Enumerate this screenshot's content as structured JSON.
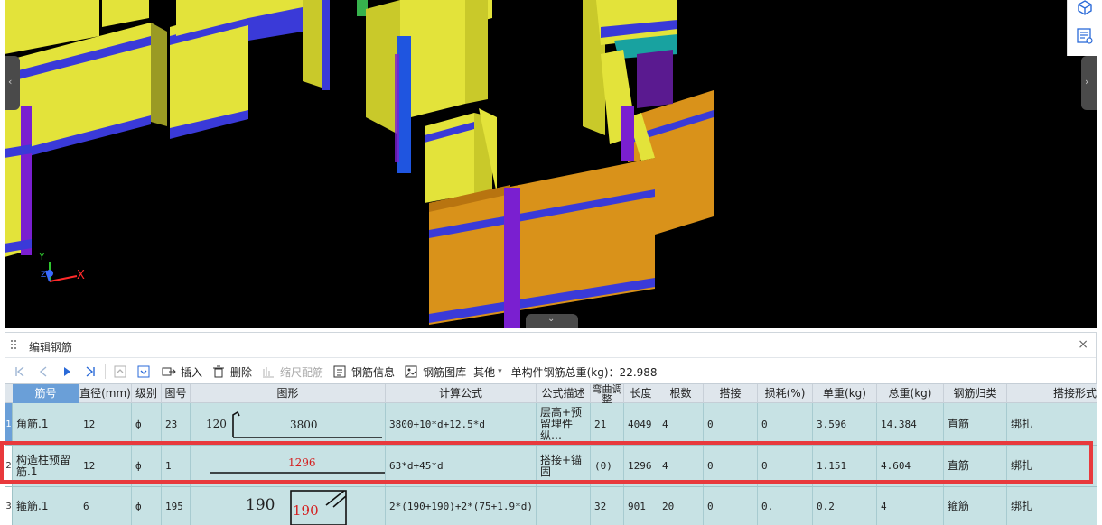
{
  "viewport": {
    "axis_labels": {
      "x": "X",
      "y": "Y",
      "z": "Z"
    },
    "icons": [
      "cube-icon",
      "layer-view-icon"
    ]
  },
  "panel": {
    "title": "编辑钢筋",
    "close": "×"
  },
  "toolbar": {
    "insert": "插入",
    "delete": "删除",
    "scale_bars": "缩尺配筋",
    "rebar_info": "钢筋信息",
    "rebar_library": "钢筋图库",
    "other": "其他",
    "other_arrow": "▾",
    "total_weight": "单构件钢筋总重(kg)：22.988"
  },
  "table": {
    "headers": [
      "筋号",
      "直径(mm)",
      "级别",
      "图号",
      "图形",
      "计算公式",
      "公式描述",
      "弯曲调整",
      "长度",
      "根数",
      "搭接",
      "损耗(%)",
      "单重(kg)",
      "总重(kg)",
      "钢筋归类",
      "搭接形式"
    ],
    "rows": [
      {
        "num": "1",
        "name": "角筋.1",
        "dia": "12",
        "grade": "ф",
        "fig": "23",
        "shape": {
          "left": "120",
          "main": "3800"
        },
        "formula": "3800+10*d+12.5*d",
        "desc": "层高+预留埋件纵…",
        "bend": "21",
        "length": "4049",
        "count": "4",
        "lap": "0",
        "loss": "0",
        "unit_wt": "3.596",
        "total_wt": "14.384",
        "class": "直筋",
        "lap_type": "绑扎"
      },
      {
        "num": "2",
        "name": "构造柱预留筋.1",
        "dia": "12",
        "grade": "ф",
        "fig": "1",
        "shape": {
          "main": "1296"
        },
        "formula": "63*d+45*d",
        "desc": "搭接+锚固",
        "bend": "(0)",
        "length": "1296",
        "count": "4",
        "lap": "0",
        "loss": "0",
        "unit_wt": "1.151",
        "total_wt": "4.604",
        "class": "直筋",
        "lap_type": "绑扎"
      },
      {
        "num": "3",
        "name": "箍筋.1",
        "dia": "6",
        "grade": "ф",
        "fig": "195",
        "shape": {
          "left": "190",
          "main": "190"
        },
        "formula": "2*(190+190)+2*(75+1.9*d)",
        "desc": "",
        "bend": "32",
        "length": "901",
        "count": "20",
        "lap": "0",
        "loss": "0.",
        "unit_wt": "0.2",
        "total_wt": "4",
        "class": "箍筋",
        "lap_type": "绑扎"
      }
    ]
  },
  "colors": {
    "row_bg": "#c7e2e4",
    "header_bg": "#dfe6ec",
    "selected_header": "#6a9fd8",
    "highlight_border": "#e8393c",
    "shape_red": "#d42020",
    "wall_yellow": "#e3e33a",
    "wall_orange": "#d9921a",
    "band_blue": "#3a3ad8",
    "column_purple": "#7a1fd0"
  }
}
